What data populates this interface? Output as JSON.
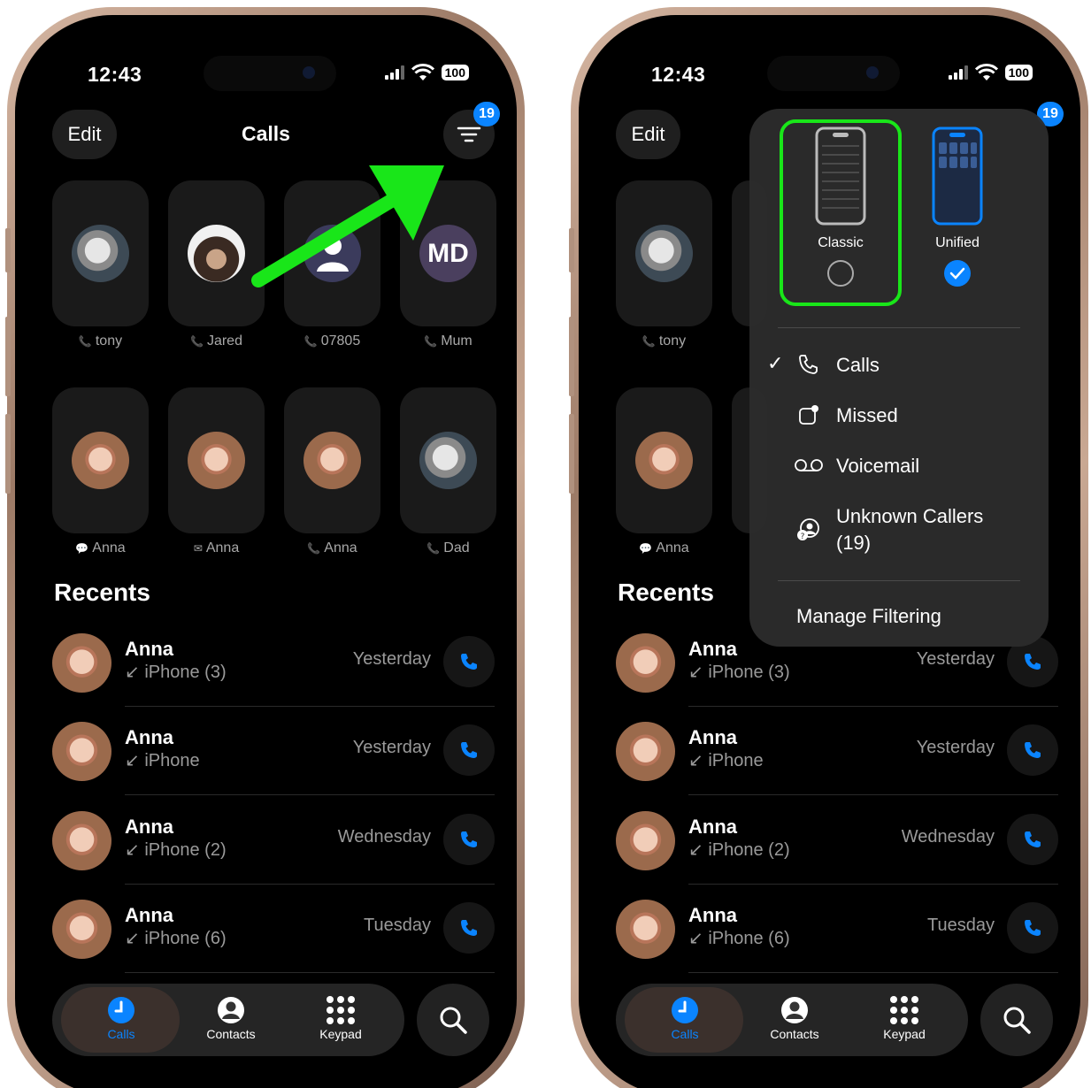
{
  "status": {
    "time": "12:43",
    "battery": "100"
  },
  "header": {
    "edit": "Edit",
    "title": "Calls",
    "badge": "19"
  },
  "favorites": [
    {
      "name": "tony",
      "type": "phone"
    },
    {
      "name": "Jared",
      "type": "phone"
    },
    {
      "name": "07805",
      "type": "phone"
    },
    {
      "name": "Mum",
      "type": "phone",
      "initials": "MD"
    },
    {
      "name": "Anna",
      "type": "message"
    },
    {
      "name": "Anna",
      "type": "mail"
    },
    {
      "name": "Anna",
      "type": "phone"
    },
    {
      "name": "Dad",
      "type": "phone"
    }
  ],
  "recents": {
    "heading": "Recents",
    "rows": [
      {
        "name": "Anna",
        "detail": "iPhone (3)",
        "date": "Yesterday"
      },
      {
        "name": "Anna",
        "detail": "iPhone",
        "date": "Yesterday"
      },
      {
        "name": "Anna",
        "detail": "iPhone (2)",
        "date": "Wednesday"
      },
      {
        "name": "Anna",
        "detail": "iPhone (6)",
        "date": "Tuesday"
      }
    ]
  },
  "tabbar": {
    "calls": "Calls",
    "contacts": "Contacts",
    "keypad": "Keypad"
  },
  "menu": {
    "classic": "Classic",
    "unified": "Unified",
    "items": [
      {
        "label": "Calls",
        "checked": true,
        "icon": "phone-icon"
      },
      {
        "label": "Missed",
        "checked": false,
        "icon": "missed-icon"
      },
      {
        "label": "Voicemail",
        "checked": false,
        "icon": "voicemail-icon"
      },
      {
        "label": "Unknown Callers\n(19)",
        "checked": false,
        "icon": "unknown-callers-icon"
      }
    ],
    "manage": "Manage Filtering"
  },
  "colors": {
    "accent": "#0a84ff",
    "highlight": "#19e619"
  }
}
